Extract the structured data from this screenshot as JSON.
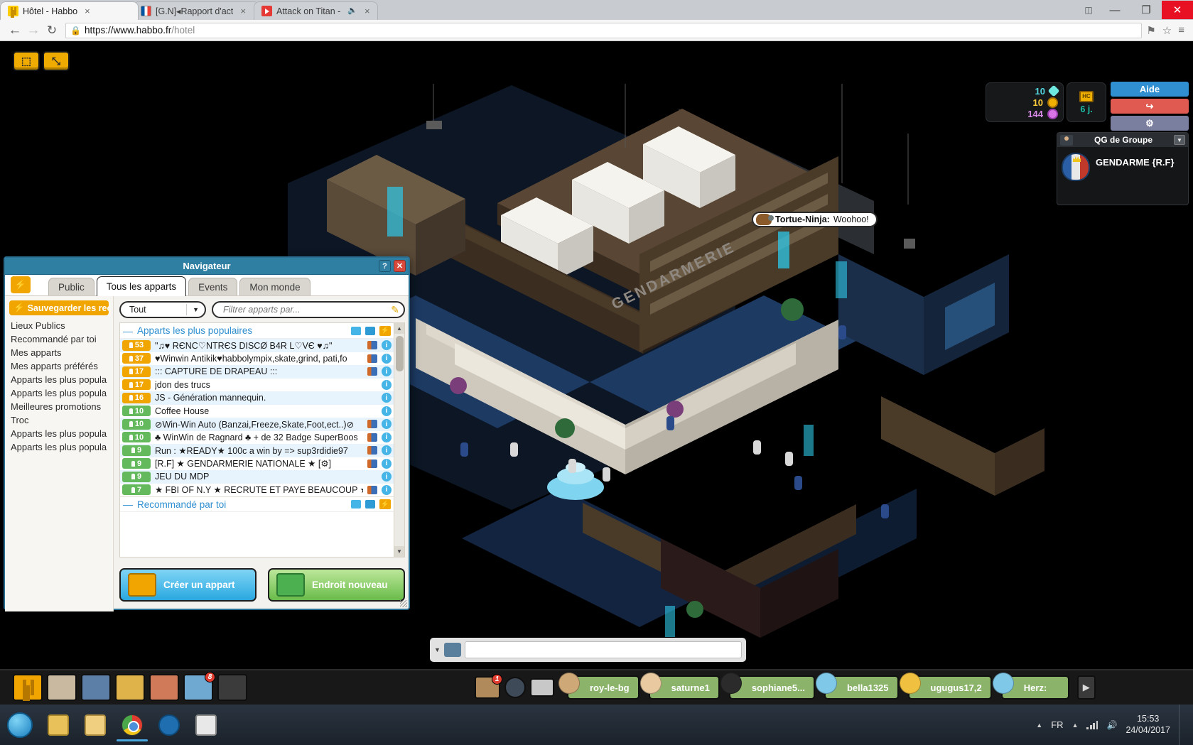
{
  "browser": {
    "tabs": [
      {
        "title": "Hôtel - Habbo",
        "favicon": "habbo-icon",
        "active": true,
        "close": "×"
      },
      {
        "title": "[G.N]◂Rapport d'act",
        "favicon": "france-flag-icon",
        "active": false,
        "close": "×"
      },
      {
        "title": "Attack on Titan -",
        "favicon": "youtube-icon",
        "active": false,
        "close": "×"
      }
    ],
    "window_controls": {
      "minimize": "—",
      "restore": "❐",
      "maximize": "□",
      "close": "✕"
    },
    "nav": {
      "back": "←",
      "forward": "→",
      "reload": "↻",
      "menu": "≡",
      "star": "☆",
      "profile": "⚑"
    },
    "omnibox": {
      "lock": "🔒",
      "url_secure": "https://www.habbo.fr",
      "url_path": "/hotel",
      "full_url": "https://www.habbo.fr/hotel"
    }
  },
  "hud": {
    "toolbar_left": {
      "fullscreen_glyph": "⬚",
      "expand_glyph": "⤡"
    },
    "credits": [
      {
        "amount": "10",
        "currency": "diamonds",
        "color": "#53d6e0"
      },
      {
        "amount": "10",
        "currency": "credits",
        "color": "#ffcf3b"
      },
      {
        "amount": "144",
        "currency": "duckets",
        "color": "#d98ae8"
      }
    ],
    "hc": {
      "badge": "HC",
      "days_left": "6 j."
    },
    "actions": [
      {
        "label": "Aide",
        "name": "help-button",
        "color": "#2f8fd0"
      },
      {
        "label": "↪",
        "name": "logout-button",
        "color": "#e05a52"
      },
      {
        "label": "⚙",
        "name": "settings-button",
        "color": "#7a7fa0"
      }
    ],
    "group": {
      "header": "QG de Groupe",
      "name": "GENDARME {R.F}",
      "caret": "▼"
    }
  },
  "room": {
    "chat_bubble": {
      "speaker": "Tortue-Ninja:",
      "message": "Woohoo!"
    },
    "wall_text": "GENDARMERIE",
    "chat_input_placeholder": ""
  },
  "navigator": {
    "title": "Navigateur",
    "help_btn": "?",
    "close_btn": "✕",
    "bolt_btn": "⚡",
    "tabs": [
      {
        "label": "Public",
        "active": false
      },
      {
        "label": "Tous les apparts",
        "active": true
      },
      {
        "label": "Events",
        "active": false
      },
      {
        "label": "Mon monde",
        "active": false
      }
    ],
    "sidebar": {
      "save_button": "Sauvegarder les rec",
      "save_bolt": "⚡",
      "items": [
        "Lieux Publics",
        "Recommandé par toi",
        "Mes apparts",
        "Mes apparts préférés",
        "Apparts les plus popula",
        "Apparts les plus popula",
        "Meilleures promotions",
        "Troc",
        "Apparts les plus popula",
        "Apparts les plus popula"
      ]
    },
    "filter": {
      "select_value": "Tout",
      "select_caret": "▼",
      "search_placeholder": "Filtrer apparts par...",
      "search_value": "",
      "pencil_icon": "✎"
    },
    "sections": [
      {
        "title": "Apparts les plus populaires",
        "minus": "—",
        "view_grid": "grid-view-icon",
        "view_list": "list-view-icon",
        "view_bolt": "⚡",
        "rooms": [
          {
            "count": "53",
            "count_color": "orange",
            "name": "\"♫♥ RЄNC♡NTRЄS DISCØ B4R L♡VЄ ♥♫\"",
            "has_group": true
          },
          {
            "count": "37",
            "count_color": "orange",
            "name": "♥Winwin Antikik♥habbolympix,skate,grind, pati,fo",
            "has_group": true
          },
          {
            "count": "17",
            "count_color": "orange",
            "name": "::: CAPTURE DE DRAPEAU :::",
            "has_group": true
          },
          {
            "count": "17",
            "count_color": "orange",
            "name": "jdon des trucs",
            "has_group": false
          },
          {
            "count": "16",
            "count_color": "orange",
            "name": "JS - Génération mannequin.",
            "has_group": false
          },
          {
            "count": "10",
            "count_color": "green",
            "name": "Coffee House",
            "has_group": false
          },
          {
            "count": "10",
            "count_color": "green",
            "name": "⊘Win-Win Auto (Banzai,Freeze,Skate,Foot,ect..)⊘",
            "has_group": true
          },
          {
            "count": "10",
            "count_color": "green",
            "name": "♣ WinWin de Ragnard ♣ + de 32 Badge SuperBoos",
            "has_group": true
          },
          {
            "count": "9",
            "count_color": "green",
            "name": "Run : ★READY★  100c a win   by => sup3rdidie97",
            "has_group": true
          },
          {
            "count": "9",
            "count_color": "green",
            "name": "[R.F] ★ GENDARMERIE NATIONALE ★ [⚙]",
            "has_group": true
          },
          {
            "count": "9",
            "count_color": "green",
            "name": "JEU DU MDP",
            "has_group": false
          },
          {
            "count": "7",
            "count_color": "green",
            "name": "★ FBI OF N.Y ★ RECRUTE ET PAYE BEAUCOUP ★",
            "has_group": true
          }
        ]
      },
      {
        "title": "Recommandé par toi",
        "minus": "—",
        "view_grid": "grid-view-icon",
        "view_list": "list-view-icon",
        "view_bolt": "⚡",
        "rooms": []
      }
    ],
    "footer": {
      "create_room": "Créer un appart",
      "new_place": "Endroit nouveau"
    },
    "scroll": {
      "up": "▲",
      "down": "▼"
    }
  },
  "gamebar": {
    "icons": [
      {
        "name": "habbo-home-icon",
        "badge": ""
      },
      {
        "name": "room-info-icon",
        "badge": ""
      },
      {
        "name": "catalog-icon",
        "badge": ""
      },
      {
        "name": "build-mode-icon",
        "badge": ""
      },
      {
        "name": "inventory-icon",
        "badge": ""
      },
      {
        "name": "friends-icon",
        "badge": "8"
      },
      {
        "name": "camera-icon",
        "badge": ""
      }
    ],
    "mid_icons": [
      {
        "name": "people-icon",
        "badge": "1"
      },
      {
        "name": "search-icon",
        "badge": ""
      },
      {
        "name": "chat-icon",
        "badge": ""
      }
    ],
    "users": [
      {
        "name": "roy-le-bg"
      },
      {
        "name": "saturne1"
      },
      {
        "name": "sophiane5..."
      },
      {
        "name": "bella1325"
      },
      {
        "name": "ugugus17,2"
      },
      {
        "name": "Herz:"
      }
    ],
    "next_arrow": "▶"
  },
  "taskbar": {
    "start": "start-orb",
    "apps": [
      {
        "name": "explorer-icon",
        "active": false
      },
      {
        "name": "folder-icon",
        "active": false
      },
      {
        "name": "chrome-icon",
        "active": true
      },
      {
        "name": "internet-explorer-icon",
        "active": false
      },
      {
        "name": "paint-icon",
        "active": false
      }
    ],
    "tray": {
      "lang": "FR",
      "caret": "▲",
      "signal": "wifi-icon",
      "volume": "🔊",
      "time": "15:53",
      "date": "24/04/2017"
    }
  }
}
